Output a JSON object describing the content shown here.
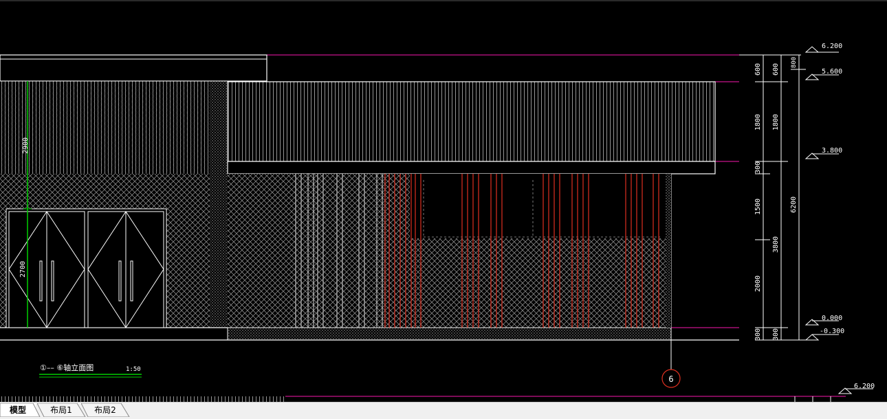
{
  "drawing": {
    "title": "①–– ⑥轴立面图",
    "scale": "1:50",
    "axis_bubble": "6",
    "elevations": [
      "6.200",
      "5.600",
      "3.800",
      "0.000",
      "-0.300"
    ],
    "lower_view_elevation": "6.200",
    "dims_left": [
      "2900",
      "2700"
    ],
    "dims_col1": [
      "600",
      "1800",
      "300",
      "1500",
      "2000",
      "300"
    ],
    "dims_col2": [
      "600",
      "1800",
      "3800",
      "300"
    ],
    "dims_col3_top": "800",
    "dims_total": "6200"
  },
  "tabs": [
    {
      "label": "模型",
      "active": true
    },
    {
      "label": "布局1",
      "active": false
    },
    {
      "label": "布局2",
      "active": false
    }
  ],
  "colors": {
    "background": "#000000",
    "line_white": "#ffffff",
    "line_magenta": "#c8148c",
    "line_red": "#e03020",
    "line_green": "#00d000",
    "hatch_gray": "#9a9a9a"
  }
}
